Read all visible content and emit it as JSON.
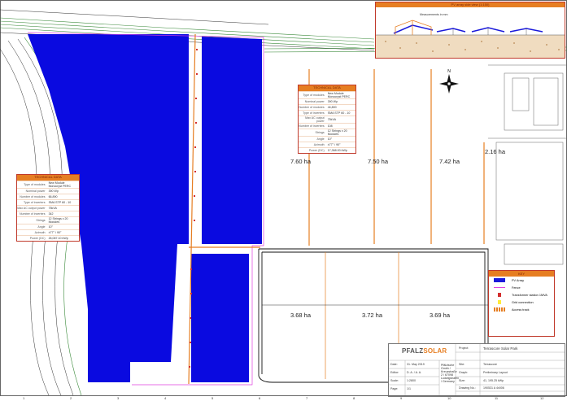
{
  "section": {
    "title": "PV array side view (1:150)",
    "note": "Measurements in mm"
  },
  "tech_left": {
    "title": "TECHNICAL DATA",
    "rows": [
      {
        "k": "Type of modules",
        "v": "New Module Monocryst PERC"
      },
      {
        "k": "Nominal power",
        "v": "390 Wp"
      },
      {
        "k": "Number of modules",
        "v": "66,890"
      },
      {
        "k": "Type of inverters",
        "v": "SMA STP 60 - 10"
      },
      {
        "k": "Max AC output power",
        "v": "75kVA"
      },
      {
        "k": "Number of inverters",
        "v": "342"
      },
      {
        "k": "Strings",
        "v": "12 Strings x 20 Modules"
      },
      {
        "k": "Angle",
        "v": "10°"
      },
      {
        "k": "Azimuth",
        "v": "±77° / 90°"
      },
      {
        "k": "Power (DC)",
        "v": "26,087.10 kWp"
      }
    ]
  },
  "tech_right": {
    "title": "TECHNICAL DATA",
    "rows": [
      {
        "k": "Type of modules",
        "v": "New Module Monocryst PERC"
      },
      {
        "k": "Nominal power",
        "v": "390 Wp"
      },
      {
        "k": "Number of modules",
        "v": "44,800"
      },
      {
        "k": "Type of inverters",
        "v": "SMA STP 60 - 10"
      },
      {
        "k": "Max AC output power",
        "v": "75kVA"
      },
      {
        "k": "Number of inverters",
        "v": "108"
      },
      {
        "k": "Strings",
        "v": "12 Strings x 20 Modules"
      },
      {
        "k": "Angle",
        "v": "10°"
      },
      {
        "k": "Azimuth",
        "v": "±77° / 90°"
      },
      {
        "k": "Power (DC)",
        "v": "17,368.00 kWp"
      }
    ]
  },
  "areas": [
    "7.60 ha",
    "7.50 ha",
    "7.42 ha",
    "2.16 ha",
    "3.68 ha",
    "3.72 ha",
    "3.69 ha"
  ],
  "legend": {
    "title": "KEY",
    "items": [
      {
        "label": "PV Array",
        "color": "#1a1adb"
      },
      {
        "label": "Fence",
        "color": "#e040e0"
      },
      {
        "label": "Transformer station 1MVA",
        "color": "#d32f2f"
      },
      {
        "label": "Grid connection",
        "color": "#ffeb3b"
      },
      {
        "label": "Access track",
        "color": "#e67e22"
      }
    ]
  },
  "title_block": {
    "company": "PFALZ",
    "company_accent": "SOLAR",
    "project_label": "Project:",
    "project": "Terrascore Solar Park",
    "date_label": "Date:",
    "date": "31. May 2019",
    "editor_label": "Editor:",
    "editor": "D. A. / A. A.",
    "scale_label": "Scale:",
    "scale": "1:2800",
    "page_label": "Page:",
    "page": "1/1",
    "address": "Pfälzische Gmbh / Kreuzstraße 2 / 67098 Ludwigshafen / Germany",
    "site_label": "Site:",
    "site": "Terrascore",
    "graph_label": "Graph:",
    "graph": "Preliminary Layout",
    "size_label": "Size:",
    "size": "41, 195.25 kWp",
    "drawing_label": "Drawing No.:",
    "drawing": "190531 A 4x006"
  },
  "ruler_ticks": [
    "1",
    "2",
    "3",
    "4",
    "5",
    "6",
    "7",
    "8",
    "9",
    "10",
    "11",
    "12"
  ]
}
